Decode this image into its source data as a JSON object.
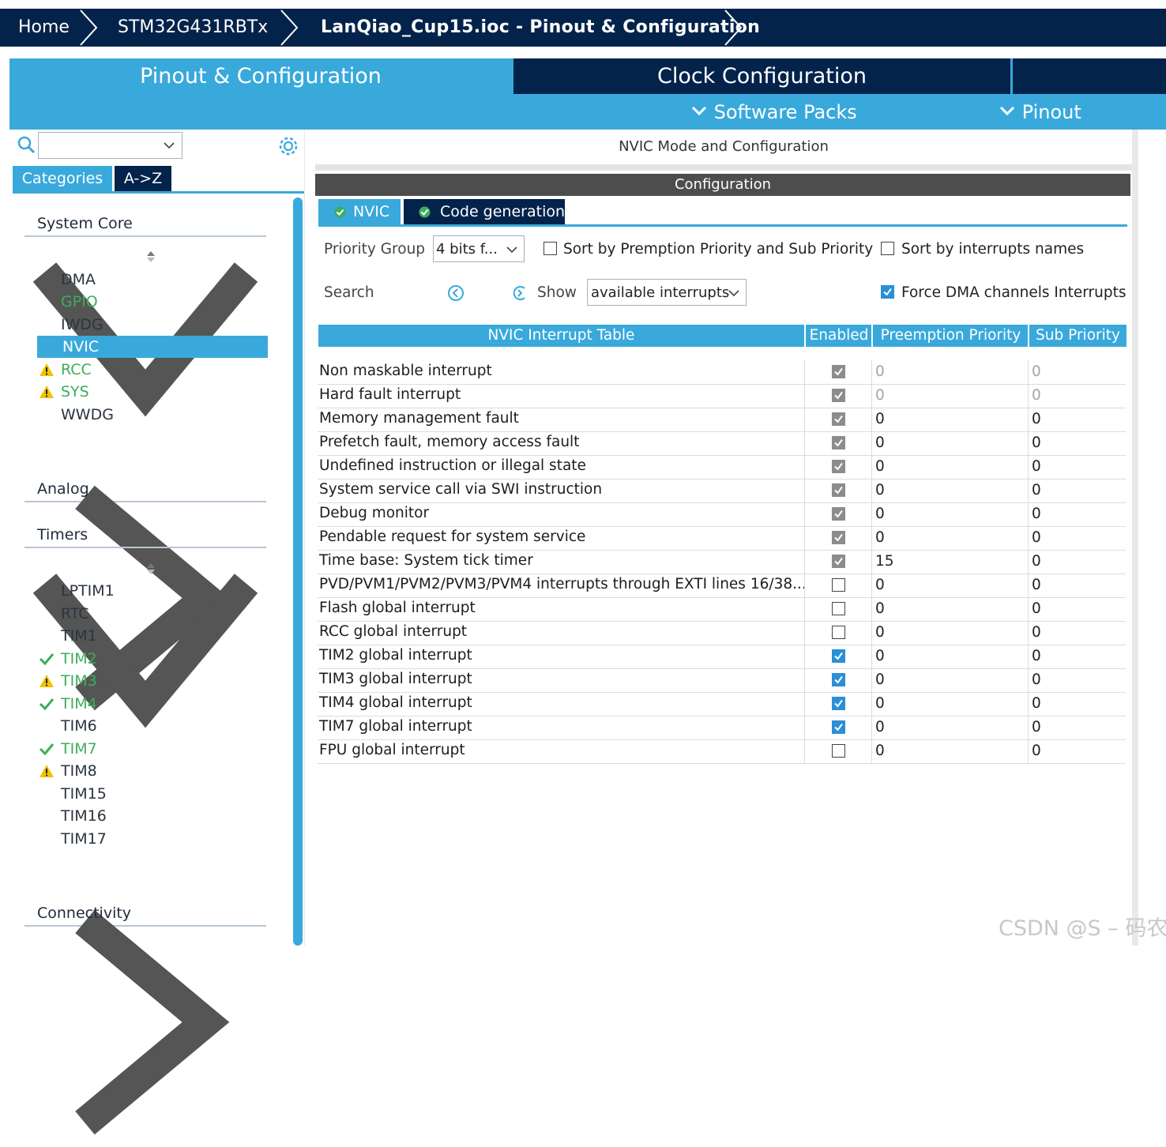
{
  "breadcrumb": [
    "Home",
    "STM32G431RBTx",
    "LanQiao_Cup15.ioc - Pinout & Configuration"
  ],
  "tabs": {
    "pinout": "Pinout & Configuration",
    "clock": "Clock Configuration"
  },
  "subnav": {
    "software_packs": "Software Packs",
    "pinout": "Pinout"
  },
  "sidebar": {
    "search_value": "",
    "view_tabs": [
      "Categories",
      "A->Z"
    ],
    "categories": [
      {
        "label": "System Core",
        "expanded": true,
        "items": [
          {
            "label": "DMA",
            "status": "none"
          },
          {
            "label": "GPIO",
            "status": "green"
          },
          {
            "label": "IWDG",
            "status": "none"
          },
          {
            "label": "NVIC",
            "status": "selected"
          },
          {
            "label": "RCC",
            "status": "warning"
          },
          {
            "label": "SYS",
            "status": "warning"
          },
          {
            "label": "WWDG",
            "status": "none"
          }
        ]
      },
      {
        "label": "Analog",
        "expanded": false
      },
      {
        "label": "Timers",
        "expanded": true,
        "items": [
          {
            "label": "LPTIM1",
            "status": "none"
          },
          {
            "label": "RTC",
            "status": "none"
          },
          {
            "label": "TIM1",
            "status": "none"
          },
          {
            "label": "TIM2",
            "status": "ok"
          },
          {
            "label": "TIM3",
            "status": "warning"
          },
          {
            "label": "TIM4",
            "status": "ok"
          },
          {
            "label": "TIM6",
            "status": "none"
          },
          {
            "label": "TIM7",
            "status": "ok"
          },
          {
            "label": "TIM8",
            "status": "warning-plain"
          },
          {
            "label": "TIM15",
            "status": "none"
          },
          {
            "label": "TIM16",
            "status": "none"
          },
          {
            "label": "TIM17",
            "status": "none"
          }
        ]
      },
      {
        "label": "Connectivity",
        "expanded": false
      }
    ]
  },
  "main": {
    "title": "NVIC Mode and Configuration",
    "config_header": "Configuration",
    "subtabs": [
      "NVIC",
      "Code generation"
    ],
    "priority_group_label": "Priority Group",
    "priority_group_value": "4 bits f...",
    "sort_premption_label": "Sort by Premption Priority and Sub Priority",
    "sort_premption_checked": false,
    "sort_names_label": "Sort by interrupts names",
    "sort_names_checked": false,
    "search_label": "Search",
    "show_label": "Show",
    "show_value": "available interrupts",
    "force_dma_label": "Force DMA channels Interrupts",
    "force_dma_checked": true,
    "table_headers": [
      "NVIC Interrupt Table",
      "Enabled",
      "Preemption Priority",
      "Sub Priority"
    ],
    "rows": [
      {
        "name": "Non maskable interrupt",
        "enabled": "locked",
        "pp": "0",
        "sp": "0",
        "pp_disabled": true
      },
      {
        "name": "Hard fault interrupt",
        "enabled": "locked",
        "pp": "0",
        "sp": "0",
        "pp_disabled": true
      },
      {
        "name": "Memory management fault",
        "enabled": "locked",
        "pp": "0",
        "sp": "0",
        "pp_disabled": false
      },
      {
        "name": "Prefetch fault, memory access fault",
        "enabled": "locked",
        "pp": "0",
        "sp": "0",
        "pp_disabled": false
      },
      {
        "name": "Undefined instruction or illegal state",
        "enabled": "locked",
        "pp": "0",
        "sp": "0",
        "pp_disabled": false
      },
      {
        "name": "System service call via SWI instruction",
        "enabled": "locked",
        "pp": "0",
        "sp": "0",
        "pp_disabled": false
      },
      {
        "name": "Debug monitor",
        "enabled": "locked",
        "pp": "0",
        "sp": "0",
        "pp_disabled": false
      },
      {
        "name": "Pendable request for system service",
        "enabled": "locked",
        "pp": "0",
        "sp": "0",
        "pp_disabled": false
      },
      {
        "name": "Time base: System tick timer",
        "enabled": "locked",
        "pp": "15",
        "sp": "0",
        "pp_disabled": false
      },
      {
        "name": "PVD/PVM1/PVM2/PVM3/PVM4 interrupts through EXTI lines 16/38...",
        "enabled": "off",
        "pp": "0",
        "sp": "0",
        "pp_disabled": false
      },
      {
        "name": "Flash global interrupt",
        "enabled": "off",
        "pp": "0",
        "sp": "0",
        "pp_disabled": false
      },
      {
        "name": "RCC global interrupt",
        "enabled": "off",
        "pp": "0",
        "sp": "0",
        "pp_disabled": false
      },
      {
        "name": "TIM2 global interrupt",
        "enabled": "on",
        "pp": "0",
        "sp": "0",
        "pp_disabled": false
      },
      {
        "name": "TIM3 global interrupt",
        "enabled": "on",
        "pp": "0",
        "sp": "0",
        "pp_disabled": false
      },
      {
        "name": "TIM4 global interrupt",
        "enabled": "on",
        "pp": "0",
        "sp": "0",
        "pp_disabled": false
      },
      {
        "name": "TIM7 global interrupt",
        "enabled": "on",
        "pp": "0",
        "sp": "0",
        "pp_disabled": false
      },
      {
        "name": "FPU global interrupt",
        "enabled": "off",
        "pp": "0",
        "sp": "0",
        "pp_disabled": false
      }
    ]
  },
  "watermark": "CSDN @S – 码农",
  "colors": {
    "navy": "#03234b",
    "accent": "#39a9dc",
    "selected": "#39a9dc",
    "green": "#3cae5b",
    "warning": "#f2c200"
  }
}
